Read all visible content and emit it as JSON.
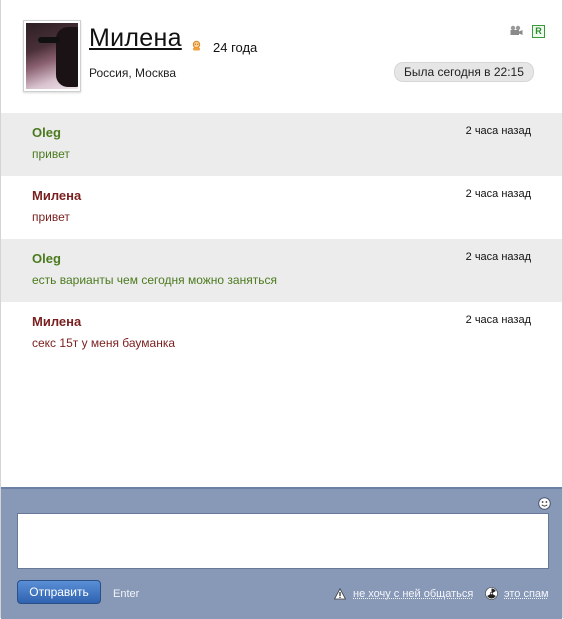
{
  "profile": {
    "name": "Милена",
    "age": "24 года",
    "location": "Россия, Москва",
    "last_seen": "Была сегодня в 22:15",
    "gender_icon": "female-icon",
    "video_icon": "video-camera-icon",
    "badge": "R"
  },
  "messages": [
    {
      "author": "Oleg",
      "time": "2 часа назад",
      "text": "привет"
    },
    {
      "author": "Милена",
      "time": "2 часа назад",
      "text": "привет"
    },
    {
      "author": "Oleg",
      "time": "2 часа назад",
      "text": "есть варианты чем сегодня можно заняться"
    },
    {
      "author": "Милена",
      "time": "2 часа назад",
      "text": "секс 15т у меня бауманка"
    }
  ],
  "compose": {
    "input_value": "",
    "send_label": "Отправить",
    "enter_hint": "Enter",
    "no_contact_label": "не хочу с ней общаться",
    "spam_label": "это спам"
  },
  "colors": {
    "oleg": "#4b7a1e",
    "milena": "#7a1f1f",
    "compose_bg": "#8899b8",
    "send_button": "#2f62b0"
  }
}
